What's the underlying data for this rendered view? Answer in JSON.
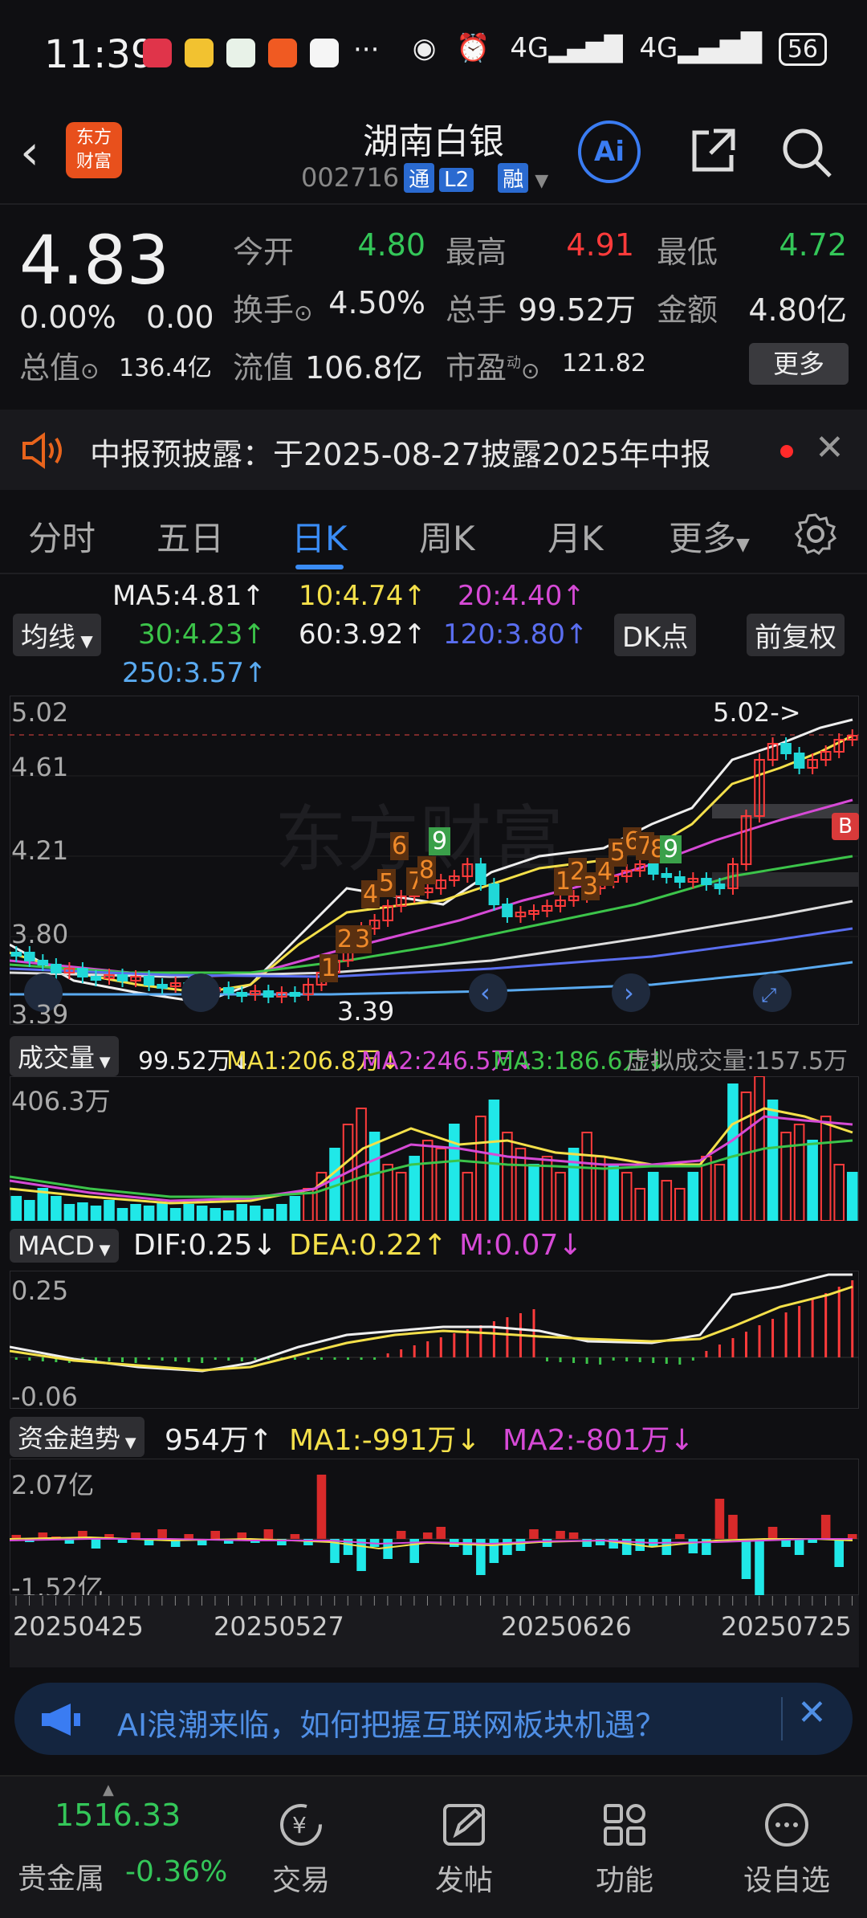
{
  "status_bar": {
    "time": "11:39",
    "battery": "56",
    "network": "4G"
  },
  "header": {
    "logo_text": "东方财富",
    "title": "湖南白银",
    "code": "002716",
    "tags": [
      "通",
      "L2",
      "融"
    ],
    "ai_label": "Ai"
  },
  "quote": {
    "price": "4.83",
    "change_pct": "0.00%",
    "change": "0.00",
    "open_label": "今开",
    "open": "4.80",
    "high_label": "最高",
    "high": "4.91",
    "low_label": "最低",
    "low": "4.72",
    "turnover_label": "换手",
    "turnover": "4.50%",
    "volume_label": "总手",
    "volume": "99.52万",
    "amount_label": "金额",
    "amount": "4.80亿",
    "mktcap_label": "总值",
    "mktcap": "136.4亿",
    "float_label": "流值",
    "float": "106.8亿",
    "pe_label": "市盈",
    "pe": "121.82",
    "more": "更多"
  },
  "notice": {
    "text": "中报预披露：于2025-08-27披露2025年中报"
  },
  "tabs": [
    "分时",
    "五日",
    "日K",
    "周K",
    "月K",
    "更多"
  ],
  "ma_legend": {
    "selector": "均线",
    "ma5": "MA5:4.81↑",
    "ma10": "10:4.74↑",
    "ma20": "20:4.40↑",
    "ma30": "30:4.23↑",
    "ma60": "60:3.92↑",
    "ma120": "120:3.80↑",
    "ma250": "250:3.57↑",
    "dk_button": "DK点",
    "fq_button": "前复权"
  },
  "kline": {
    "y_labels": [
      "5.02",
      "4.61",
      "4.21",
      "3.80",
      "3.39"
    ],
    "max_marker": "5.02->",
    "min_marker": "3.39",
    "b_marker": "B",
    "seq_up": [
      "1",
      "2",
      "3",
      "4",
      "5",
      "6",
      "7",
      "8",
      "9"
    ]
  },
  "volume": {
    "selector": "成交量",
    "v": "99.52万↓",
    "ma1": "MA1:206.8万↓",
    "ma2": "MA2:246.5万↓",
    "ma3": "MA3:186.6万↓",
    "virtual": "虚拟成交量:157.5万",
    "y_top": "406.3万"
  },
  "macd": {
    "selector": "MACD",
    "dif": "DIF:0.25↓",
    "dea": "DEA:0.22↑",
    "m": "M:0.07↓",
    "y_top": "0.25",
    "y_bottom": "-0.06"
  },
  "fund": {
    "selector": "资金趋势",
    "v": "954万↑",
    "ma1": "MA1:-991万↓",
    "ma2": "MA2:-801万↓",
    "y_top": "2.07亿",
    "y_bottom": "-1.52亿"
  },
  "dates": [
    "20250425",
    "20250527",
    "20250626",
    "20250725"
  ],
  "banner": {
    "text": "AI浪潮来临，如何把握互联网板块机遇？"
  },
  "bottom_nav": {
    "index_value": "1516.33",
    "index_name": "贵金属",
    "index_change": "-0.36%",
    "items": [
      "交易",
      "发帖",
      "功能",
      "设自选"
    ]
  }
}
